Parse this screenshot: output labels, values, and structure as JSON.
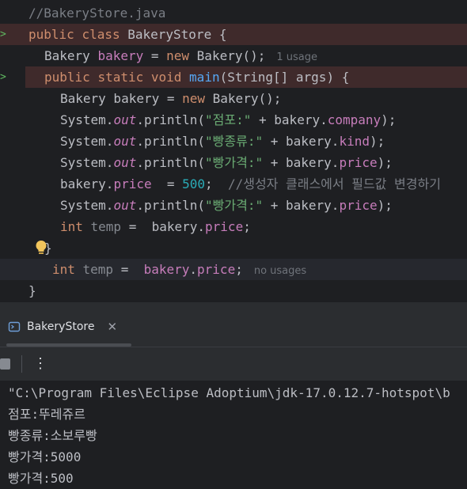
{
  "editor": {
    "lines": [
      {
        "parts": [
          {
            "t": "//BakeryStore.java",
            "c": "cmt"
          }
        ]
      },
      {
        "parts": [
          {
            "t": "public ",
            "c": "kw"
          },
          {
            "t": "class ",
            "c": "kw"
          },
          {
            "t": "BakeryStore {",
            "c": "cls"
          }
        ]
      },
      {
        "parts": [
          {
            "t": "Bakery ",
            "c": "cls"
          },
          {
            "t": "bakery",
            "c": "fld"
          },
          {
            "t": " = ",
            "c": "cls"
          },
          {
            "t": "new ",
            "c": "kw"
          },
          {
            "t": "Bakery();",
            "c": "cls"
          }
        ],
        "hint": "1 usage"
      },
      {
        "parts": [
          {
            "t": "public ",
            "c": "kw"
          },
          {
            "t": "static ",
            "c": "kw"
          },
          {
            "t": "void ",
            "c": "kw"
          },
          {
            "t": "main",
            "c": "fn"
          },
          {
            "t": "(String[] args) {",
            "c": "cls"
          }
        ]
      },
      {
        "parts": [
          {
            "t": "Bakery bakery = ",
            "c": "cls"
          },
          {
            "t": "new ",
            "c": "kw"
          },
          {
            "t": "Bakery();",
            "c": "cls"
          }
        ]
      },
      {
        "parts": [
          {
            "t": "System.",
            "c": "cls"
          },
          {
            "t": "out",
            "c": "ital"
          },
          {
            "t": ".println(",
            "c": "cls"
          },
          {
            "t": "\"점포:\"",
            "c": "str"
          },
          {
            "t": " + bakery.",
            "c": "cls"
          },
          {
            "t": "company",
            "c": "fld"
          },
          {
            "t": ");",
            "c": "cls"
          }
        ]
      },
      {
        "parts": [
          {
            "t": "System.",
            "c": "cls"
          },
          {
            "t": "out",
            "c": "ital"
          },
          {
            "t": ".println(",
            "c": "cls"
          },
          {
            "t": "\"빵종류:\"",
            "c": "str"
          },
          {
            "t": " + bakery.",
            "c": "cls"
          },
          {
            "t": "kind",
            "c": "fld"
          },
          {
            "t": ");",
            "c": "cls"
          }
        ]
      },
      {
        "parts": [
          {
            "t": "System.",
            "c": "cls"
          },
          {
            "t": "out",
            "c": "ital"
          },
          {
            "t": ".println(",
            "c": "cls"
          },
          {
            "t": "\"빵가격:\"",
            "c": "str"
          },
          {
            "t": " + bakery.",
            "c": "cls"
          },
          {
            "t": "price",
            "c": "fld"
          },
          {
            "t": ");",
            "c": "cls"
          }
        ]
      },
      {
        "parts": [
          {
            "t": "bakery.",
            "c": "cls"
          },
          {
            "t": "price",
            "c": "fld"
          },
          {
            "t": "  = ",
            "c": "cls"
          },
          {
            "t": "500",
            "c": "num"
          },
          {
            "t": ";  ",
            "c": "cls"
          },
          {
            "t": "//생성자 클래스에서 필드값 변경하기",
            "c": "cmt"
          }
        ]
      },
      {
        "parts": [
          {
            "t": "System.",
            "c": "cls"
          },
          {
            "t": "out",
            "c": "ital"
          },
          {
            "t": ".println(",
            "c": "cls"
          },
          {
            "t": "\"빵가격:\"",
            "c": "str"
          },
          {
            "t": " + bakery.",
            "c": "cls"
          },
          {
            "t": "price",
            "c": "fld"
          },
          {
            "t": ");",
            "c": "cls"
          }
        ]
      },
      {
        "parts": [
          {
            "t": "int ",
            "c": "kw"
          },
          {
            "t": "temp",
            "c": "gray"
          },
          {
            "t": " =  bakery.",
            "c": "cls"
          },
          {
            "t": "price",
            "c": "fld"
          },
          {
            "t": ";",
            "c": "cls"
          }
        ]
      },
      {
        "parts": [
          {
            "t": "}",
            "c": "cls"
          }
        ]
      },
      {
        "parts": [
          {
            "t": "int ",
            "c": "kw"
          },
          {
            "t": "temp",
            "c": "gray"
          },
          {
            "t": " =  ",
            "c": "cls"
          },
          {
            "t": "bakery",
            "c": "fld"
          },
          {
            "t": ".",
            "c": "cls"
          },
          {
            "t": "price",
            "c": "fld"
          },
          {
            "t": ";",
            "c": "cls"
          }
        ],
        "hint": "no usages"
      },
      {
        "parts": [
          {
            "t": "}",
            "c": "cls"
          }
        ]
      }
    ]
  },
  "run_panel": {
    "tab_label": "BakeryStore",
    "close_glyph": "✕",
    "more_glyph": "⋮"
  },
  "console": {
    "lines": [
      "\"C:\\Program Files\\Eclipse Adoptium\\jdk-17.0.12.7-hotspot\\b",
      "점포:뚜레쥬르",
      "빵종류:소보루빵",
      "빵가격:5000",
      "빵가격:500"
    ]
  },
  "colors": {
    "editor_bg": "#1e1f22",
    "keyword": "#cf8e6d",
    "string": "#6aab73",
    "field": "#c77dbb",
    "method": "#56a8f5",
    "number": "#2aacb8",
    "error_line_bg": "#3f2a2b"
  }
}
